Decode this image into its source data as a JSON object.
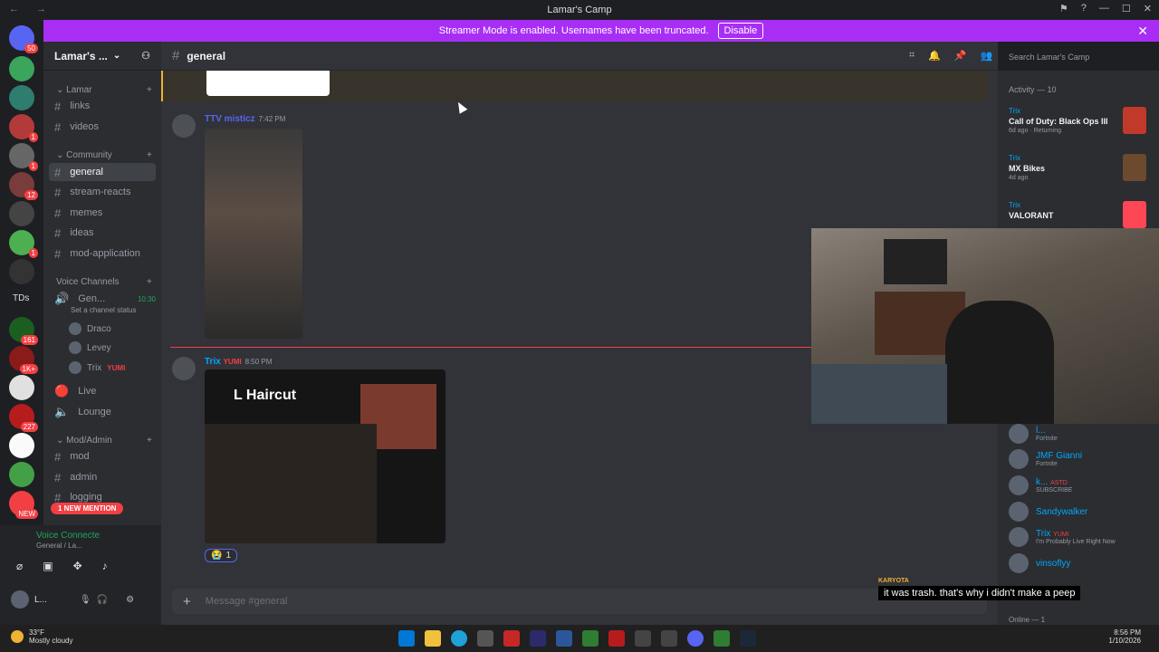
{
  "window": {
    "title": "Lamar's Camp"
  },
  "banner": {
    "text": "Streamer Mode is enabled. Usernames have been truncated.",
    "button": "Disable"
  },
  "server": {
    "name": "Lamar's ...",
    "badge_top": "50"
  },
  "server_badges": [
    "1",
    "1",
    "12",
    "1",
    "161",
    "1K+",
    "227",
    "NEW"
  ],
  "server_label_tds": "TDs",
  "categories": {
    "lamar": "Lamar",
    "community": "Community",
    "voice": "Voice Channels",
    "mod": "Mod/Admin"
  },
  "channels": {
    "links": "links",
    "videos": "videos",
    "general": "general",
    "stream_reacts": "stream-reacts",
    "memes": "memes",
    "ideas": "ideas",
    "mod_application": "mod-application",
    "voice_general": "Gen...",
    "voice_time": "10:30",
    "voice_status": "Set a channel status",
    "live": "Live",
    "lounge": "Lounge",
    "mod": "mod",
    "admin": "admin",
    "logging": "logging"
  },
  "voice_users": [
    {
      "name": "Draco"
    },
    {
      "name": "Levey"
    },
    {
      "name": "Trix",
      "tag": "YUMI"
    }
  ],
  "mention_pill": "1 NEW MENTION",
  "voice_panel": {
    "status": "Voice Connecte",
    "sub": "General / La...",
    "user": "L..."
  },
  "main": {
    "channel": "general",
    "search_placeholder": "Search Lamar's Camp",
    "composer_placeholder": "Message #general"
  },
  "messages": [
    {
      "author": "TTV misticz",
      "time": "7:42 PM",
      "color": "#5865f2"
    },
    {
      "author": "Trix",
      "tag": "YUMI",
      "time": "8:50 PM",
      "color": "#00a8fc",
      "image_title": "L Haircut",
      "reaction_count": "1"
    }
  ],
  "activity": {
    "header": "Activity — 10",
    "items": [
      {
        "user": "Trix",
        "game": "Call of Duty: Black Ops III",
        "meta": "6d ago · Returning",
        "thumb": "#c0392b"
      },
      {
        "user": "Trix",
        "game": "MX Bikes",
        "meta": "4d ago",
        "thumb": "#6b4a2e"
      },
      {
        "user": "Trix",
        "game": "VALORANT",
        "meta": "",
        "thumb": "#ff4655"
      }
    ]
  },
  "members": [
    {
      "name": "l...",
      "sub": "Fortnite"
    },
    {
      "name": "JMF Gianni",
      "sub": "Fortnite"
    },
    {
      "name": "k...",
      "tag": "ASTD",
      "sub": "SUBSCRIBE"
    },
    {
      "name": "Sandywalker",
      "sub": ""
    },
    {
      "name": "Trix",
      "tag": "YUMI",
      "sub": "I'm Probably Live Right Now"
    },
    {
      "name": "vinsoflyy",
      "sub": ""
    }
  ],
  "online_label": "Online — 1",
  "caption": {
    "name": "KARYOTA",
    "text": "it was trash. that's why i didn't make a peep"
  },
  "taskbar": {
    "temp": "33°F",
    "weather": "Mostly cloudy",
    "time": "8:56 PM",
    "date": "1/10/2026"
  }
}
